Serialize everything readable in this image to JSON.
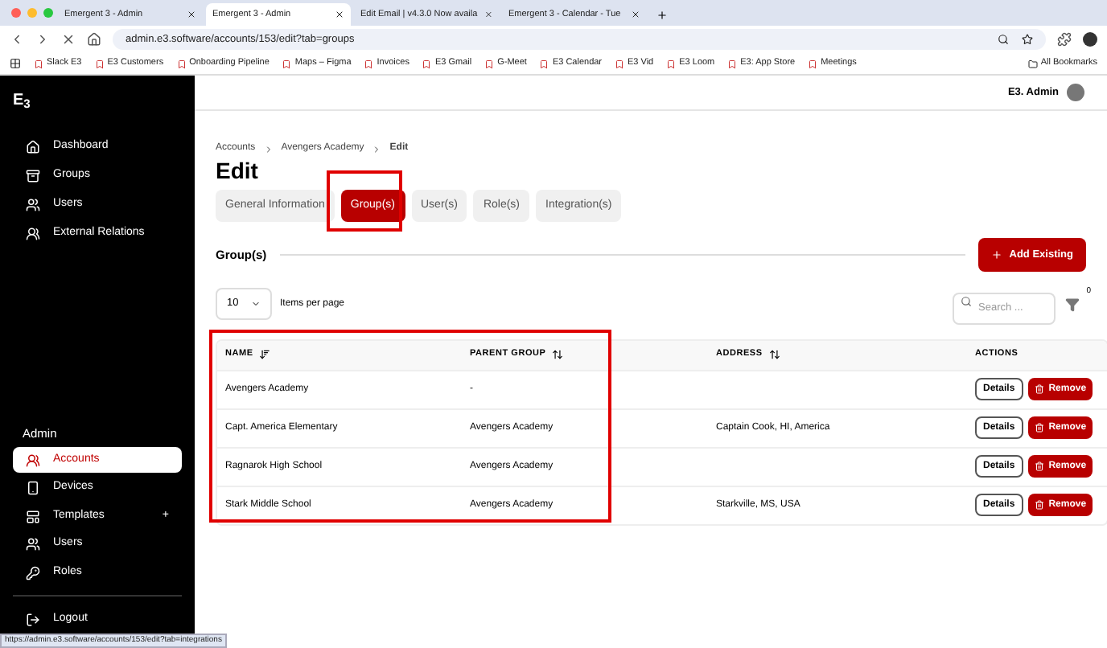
{
  "browser": {
    "tabs": [
      {
        "title": "Emergent 3 - Admin",
        "selected": false
      },
      {
        "title": "Emergent 3 - Admin",
        "selected": true
      },
      {
        "title": "Edit Email | v4.3.0 Now availa",
        "selected": false
      },
      {
        "title": "Emergent 3 - Calendar - Tue",
        "selected": false
      }
    ],
    "address": "admin.e3.software/accounts/153/edit?tab=groups",
    "bookmarks": [
      "Slack E3",
      "E3 Customers",
      "Onboarding Pipeline",
      "Maps – Figma",
      "Invoices",
      "E3 Gmail",
      "G-Meet",
      "E3 Calendar",
      "E3 Vid",
      "E3 Loom",
      "E3: App Store",
      "Meetings"
    ],
    "all_bookmarks": "All Bookmarks",
    "status_url": "https://admin.e3.software/accounts/153/edit?tab=integrations"
  },
  "sidebar": {
    "logo": "E$_{3}$",
    "items": [
      {
        "label": "Dashboard",
        "selected": false
      },
      {
        "label": "Groups",
        "selected": false
      },
      {
        "label": "Users",
        "selected": false
      },
      {
        "label": "External Relations",
        "selected": false
      }
    ],
    "admin_title": "Admin",
    "admin_items": [
      {
        "label": "Accounts",
        "selected": true
      },
      {
        "label": "Devices",
        "selected": false
      },
      {
        "label": "Templates",
        "selected": false,
        "expand_mark": "+"
      },
      {
        "label": "Users",
        "selected": false
      },
      {
        "label": "Roles",
        "selected": false
      }
    ],
    "logout": "Logout"
  },
  "header": {
    "user": "E3. Admin"
  },
  "breadcrumb": [
    "Accounts",
    "Avengers Academy",
    "Edit"
  ],
  "title": "Edit",
  "tabs": [
    {
      "label": "General Information",
      "selected": false
    },
    {
      "label": "Group(s)",
      "selected": true
    },
    {
      "label": "User(s)",
      "selected": false
    },
    {
      "label": "Role(s)",
      "selected": false
    },
    {
      "label": "Integration(s)",
      "selected": false
    }
  ],
  "section": {
    "title": "Group(s)",
    "add_button": "Add Existing"
  },
  "per_page": {
    "value": "10",
    "label": "Items per page"
  },
  "search": {
    "placeholder": "Search ..."
  },
  "filter_count": "0",
  "table": {
    "columns": [
      {
        "label": "NAME",
        "sortable": true
      },
      {
        "label": "PARENT GROUP",
        "sortable": true
      },
      {
        "label": "ADDRESS",
        "sortable": true
      },
      {
        "label": "ACTIONS",
        "sortable": false
      }
    ],
    "rows": [
      {
        "name": "Avengers Academy",
        "parent": "-",
        "address": "",
        "details": "Details",
        "remove": "Remove"
      },
      {
        "name": "Capt. America Elementary",
        "parent": "Avengers Academy",
        "address": "Captain Cook, HI, America",
        "details": "Details",
        "remove": "Remove"
      },
      {
        "name": "Ragnarok High School",
        "parent": "Avengers Academy",
        "address": "",
        "details": "Details",
        "remove": "Remove"
      },
      {
        "name": "Stark Middle School",
        "parent": "Avengers Academy",
        "address": "Starkville, MS, USA",
        "details": "Details",
        "remove": "Remove"
      }
    ]
  }
}
